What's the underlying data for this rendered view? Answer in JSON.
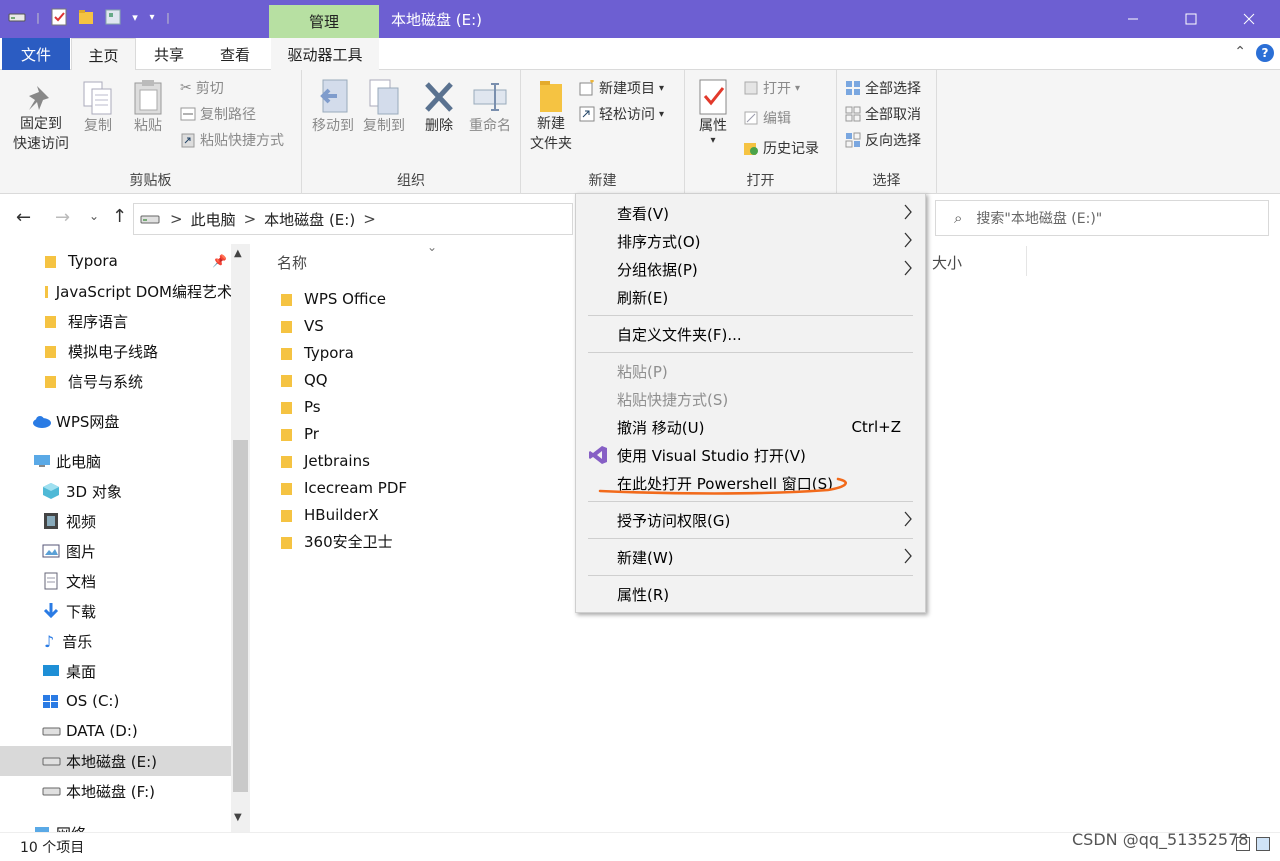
{
  "window": {
    "context_tab": "管理",
    "title": "本地磁盘 (E:)",
    "minimize_icon": "minimize-icon",
    "maximize_icon": "maximize-icon",
    "close_icon": "close-icon"
  },
  "ribbon_tabs": {
    "file": "文件",
    "home": "主页",
    "share": "共享",
    "view": "查看",
    "drive_tools": "驱动器工具"
  },
  "ribbon": {
    "clipboard": {
      "label": "剪贴板",
      "pin_line1": "固定到",
      "pin_line2": "快速访问",
      "copy": "复制",
      "paste": "粘贴",
      "cut": "剪切",
      "copy_path": "复制路径",
      "paste_shortcut": "粘贴快捷方式"
    },
    "organize": {
      "label": "组织",
      "move_to": "移动到",
      "copy_to": "复制到",
      "delete": "删除",
      "rename": "重命名"
    },
    "new": {
      "label": "新建",
      "new_folder_line1": "新建",
      "new_folder_line2": "文件夹",
      "new_item": "新建项目",
      "easy_access": "轻松访问"
    },
    "open": {
      "label": "打开",
      "properties": "属性",
      "open": "打开",
      "edit": "编辑",
      "history": "历史记录"
    },
    "select": {
      "label": "选择",
      "select_all": "全部选择",
      "select_none": "全部取消",
      "invert": "反向选择"
    }
  },
  "address": {
    "part1": "此电脑",
    "part2": "本地磁盘 (E:)",
    "sep": ">"
  },
  "search": {
    "placeholder": "搜索\"本地磁盘 (E:)\""
  },
  "columns": {
    "name": "名称",
    "size": "大小"
  },
  "sidebar": {
    "items": [
      {
        "label": "Typora"
      },
      {
        "label": "JavaScript DOM编程艺术"
      },
      {
        "label": "程序语言"
      },
      {
        "label": "模拟电子线路"
      },
      {
        "label": "信号与系统"
      },
      {
        "label": "WPS网盘"
      },
      {
        "label": "此电脑"
      },
      {
        "label": "3D 对象"
      },
      {
        "label": "视频"
      },
      {
        "label": "图片"
      },
      {
        "label": "文档"
      },
      {
        "label": "下载"
      },
      {
        "label": "音乐"
      },
      {
        "label": "桌面"
      },
      {
        "label": "OS (C:)"
      },
      {
        "label": "DATA (D:)"
      },
      {
        "label": "本地磁盘 (E:)"
      },
      {
        "label": "本地磁盘 (F:)"
      },
      {
        "label": "网络"
      }
    ]
  },
  "files": [
    {
      "name": "WPS Office"
    },
    {
      "name": "VS"
    },
    {
      "name": "Typora"
    },
    {
      "name": "QQ"
    },
    {
      "name": "Ps"
    },
    {
      "name": "Pr"
    },
    {
      "name": "Jetbrains"
    },
    {
      "name": "Icecream PDF"
    },
    {
      "name": "HBuilderX"
    },
    {
      "name": "360安全卫士"
    }
  ],
  "context_menu": {
    "view": "查看(V)",
    "sort": "排序方式(O)",
    "group": "分组依据(P)",
    "refresh": "刷新(E)",
    "customize": "自定义文件夹(F)...",
    "paste": "粘贴(P)",
    "paste_shortcut": "粘贴快捷方式(S)",
    "undo": "撤消 移动(U)",
    "undo_shortcut": "Ctrl+Z",
    "open_vs": "使用 Visual Studio 打开(V)",
    "open_powershell": "在此处打开 Powershell 窗口(S)",
    "grant_access": "授予访问权限(G)",
    "new": "新建(W)",
    "properties": "属性(R)"
  },
  "status": {
    "count": "10 个项目"
  },
  "watermark": "CSDN @qq_51352578",
  "colors": {
    "titlebar": "#6d5fd2",
    "file_tab": "#2b5cc2",
    "context_tab": "#b7e0a2",
    "annotation": "#f26a1b",
    "folder": "#f5c342"
  }
}
